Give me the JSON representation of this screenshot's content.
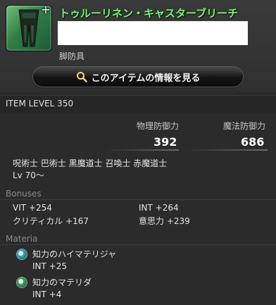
{
  "item": {
    "name": "トゥルーリネン・キャスターブリーチ",
    "category": "脚防具",
    "view_button_label": "このアイテムの情報を見る",
    "item_level": "ITEM LEVEL 350"
  },
  "stats": {
    "physical_label": "物理防御力",
    "physical_value": "392",
    "magic_label": "魔法防御力",
    "magic_value": "686"
  },
  "jobs": "呪術士 巴術士 黒魔道士 召喚士 赤魔道士",
  "level_req": "Lv 70～",
  "bonuses": {
    "title": "Bonuses",
    "items": [
      {
        "label": "VIT +254"
      },
      {
        "label": "INT +264"
      },
      {
        "label": "クリティカル +167"
      },
      {
        "label": "意思力 +239"
      }
    ]
  },
  "materia": {
    "title": "Materia",
    "slots": [
      {
        "name": "知力のハイマテリジャ",
        "stat": "INT +25",
        "color": "#2fb6c8"
      },
      {
        "name": "知力のマテリダ",
        "stat": "INT +4",
        "color": "#3fae5a"
      }
    ]
  },
  "icons": {
    "item": "leg-armor-icon",
    "plus": "plus-icon",
    "search": "magnifier-icon"
  }
}
